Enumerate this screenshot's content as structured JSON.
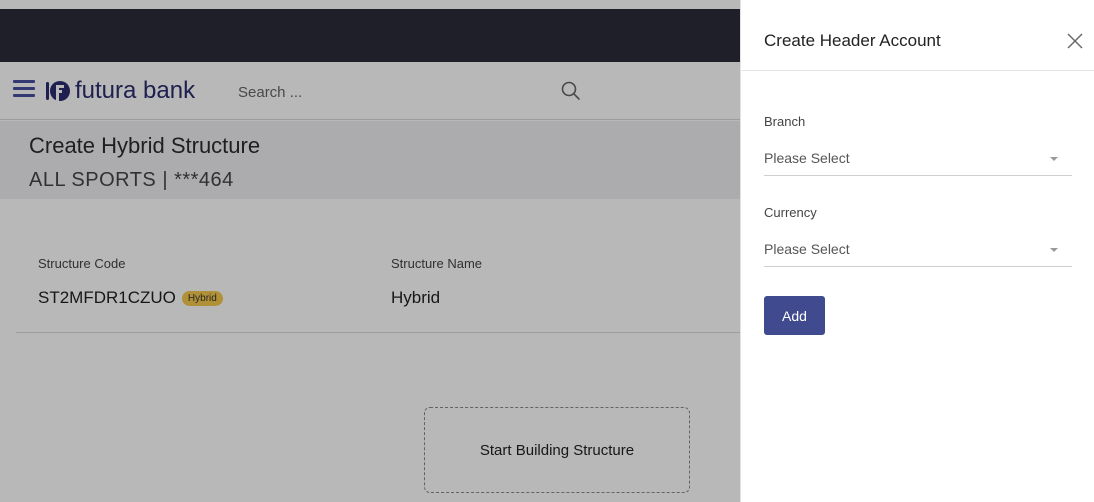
{
  "header": {
    "logo_text": "futura bank",
    "search_placeholder": "Search ..."
  },
  "page": {
    "title": "Create Hybrid Structure",
    "subtitle": "ALL SPORTS | ***464",
    "structure_code_label": "Structure Code",
    "structure_code_value": "ST2MFDR1CZUO",
    "structure_code_badge": "Hybrid",
    "structure_name_label": "Structure Name",
    "structure_name_value": "Hybrid",
    "start_building_label": "Start Building Structure"
  },
  "panel": {
    "title": "Create Header Account",
    "branch_label": "Branch",
    "branch_value": "Please Select",
    "currency_label": "Currency",
    "currency_value": "Please Select",
    "add_label": "Add"
  },
  "colors": {
    "accent": "#3f4a8f",
    "badge": "#f6c94d",
    "top_bar": "#2a2b38"
  }
}
